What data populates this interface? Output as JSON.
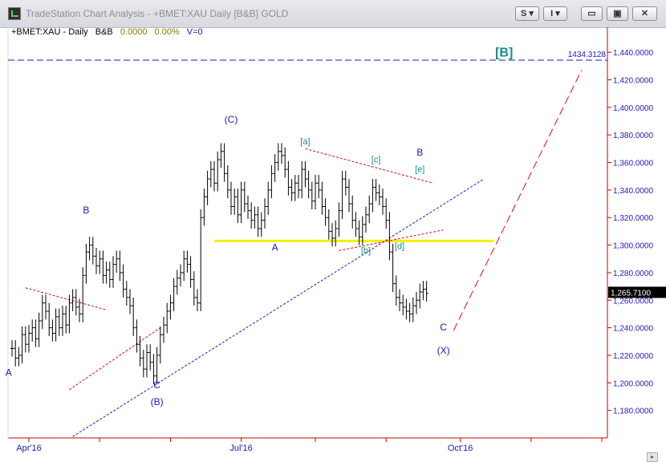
{
  "window": {
    "title": "TradeStation Chart Analysis - +BMET:XAU Daily [B&B] GOLD",
    "menu_s": "S",
    "menu_i": "I",
    "min_icon": "minimize-icon",
    "max_icon": "maximize-icon",
    "close_icon": "close-icon"
  },
  "info": {
    "symbol": "+BMET:XAU - Daily",
    "study": "B&B",
    "value": "0.0000",
    "pct": "0.00%",
    "v": "V=0"
  },
  "colors": {
    "price_bars": "#000000",
    "support_line": "#f0f000",
    "labels_blue": "#1a1ab8",
    "labels_teal": "#1a8a8a",
    "trend_red": "#d01010",
    "trend_blue": "#1a1ab8",
    "axis_red": "#cc0000"
  },
  "chart_data": {
    "type": "ohlc-bar",
    "yaxis": {
      "range": [
        1160,
        1450
      ],
      "ticks": [
        "1,180.0000",
        "1,200.0000",
        "1,220.0000",
        "1,240.0000",
        "1,260.0000",
        "1,280.0000",
        "1,300.0000",
        "1,320.0000",
        "1,340.0000",
        "1,360.0000",
        "1,380.0000",
        "1,400.0000",
        "1,420.0000",
        "1,440.0000"
      ],
      "tick_values": [
        1180,
        1200,
        1220,
        1240,
        1260,
        1280,
        1300,
        1320,
        1340,
        1360,
        1380,
        1400,
        1420,
        1440
      ]
    },
    "xaxis": {
      "labels": [
        {
          "text": "Apr'16",
          "bar": 5
        },
        {
          "text": "Jul'16",
          "bar": 68
        },
        {
          "text": "Oct'16",
          "bar": 133
        }
      ],
      "gridlines_at_bars": [
        5,
        26,
        47,
        68,
        90,
        111,
        133,
        154,
        175
      ]
    },
    "current_price": "1,265.7100",
    "current_value": 1265.71,
    "level_line": {
      "label": "1434.3128",
      "value": 1434.3128
    },
    "support_level": 1303,
    "closes": [
      1225,
      1218,
      1220,
      1235,
      1228,
      1236,
      1240,
      1232,
      1245,
      1258,
      1252,
      1240,
      1236,
      1248,
      1240,
      1250,
      1242,
      1258,
      1262,
      1255,
      1250,
      1278,
      1295,
      1300,
      1292,
      1285,
      1290,
      1278,
      1282,
      1275,
      1286,
      1290,
      1280,
      1268,
      1262,
      1256,
      1240,
      1228,
      1218,
      1210,
      1222,
      1215,
      1205,
      1220,
      1235,
      1242,
      1252,
      1258,
      1270,
      1276,
      1280,
      1290,
      1286,
      1275,
      1262,
      1258,
      1320,
      1335,
      1348,
      1355,
      1345,
      1362,
      1368,
      1352,
      1340,
      1328,
      1335,
      1322,
      1340,
      1330,
      1325,
      1318,
      1322,
      1312,
      1318,
      1328,
      1340,
      1352,
      1360,
      1368,
      1365,
      1355,
      1342,
      1338,
      1345,
      1340,
      1355,
      1348,
      1340,
      1332,
      1345,
      1340,
      1328,
      1320,
      1310,
      1305,
      1312,
      1325,
      1348,
      1342,
      1330,
      1318,
      1312,
      1306,
      1315,
      1322,
      1330,
      1342,
      1338,
      1335,
      1328,
      1318,
      1295,
      1272,
      1262,
      1258,
      1255,
      1252,
      1250,
      1256,
      1260,
      1266,
      1268,
      1265
    ],
    "annotations": [
      {
        "text": "A",
        "bar": -1,
        "price": 1205,
        "class": "blue"
      },
      {
        "text": "B",
        "bar": 22,
        "price": 1323,
        "class": "blue"
      },
      {
        "text": "C",
        "bar": 43,
        "price": 1196,
        "class": "blue"
      },
      {
        "text": "(B)",
        "bar": 43,
        "price": 1184,
        "class": "blue"
      },
      {
        "text": "(C)",
        "bar": 65,
        "price": 1389,
        "class": "blue"
      },
      {
        "text": "A",
        "bar": 78,
        "price": 1296,
        "class": "blue"
      },
      {
        "text": "[a]",
        "bar": 87,
        "price": 1373,
        "class": "teal"
      },
      {
        "text": "[c]",
        "bar": 108,
        "price": 1360,
        "class": "teal"
      },
      {
        "text": "B",
        "bar": 121,
        "price": 1365,
        "class": "blue"
      },
      {
        "text": "[e]",
        "bar": 121,
        "price": 1353,
        "class": "teal"
      },
      {
        "text": "[b]",
        "bar": 105,
        "price": 1294,
        "class": "teal"
      },
      {
        "text": "[d]",
        "bar": 115,
        "price": 1297,
        "class": "teal"
      },
      {
        "text": "C",
        "bar": 128,
        "price": 1238,
        "class": "blue"
      },
      {
        "text": "(X)",
        "bar": 128,
        "price": 1221,
        "class": "blue"
      },
      {
        "text": "[B]",
        "bar": 146,
        "price": 1437,
        "class": "teal"
      }
    ]
  }
}
